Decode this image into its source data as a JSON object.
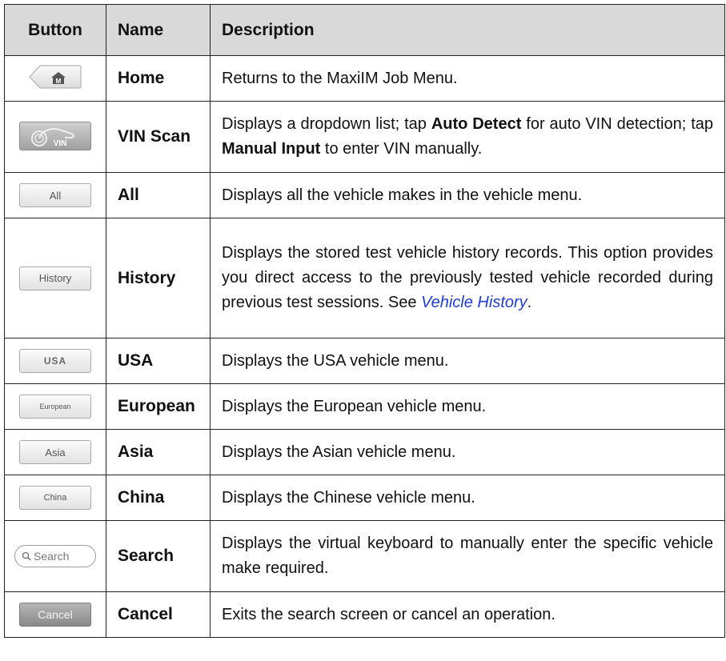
{
  "headers": {
    "button": "Button",
    "name": "Name",
    "description": "Description"
  },
  "rows": [
    {
      "icon_name": "home-icon",
      "icon_label": "",
      "name": "Home",
      "desc": [
        "Returns to the MaxiIM Job Menu."
      ]
    },
    {
      "icon_name": "vin-scan-icon",
      "icon_label": "VIN",
      "name": "VIN Scan",
      "desc": [
        "Displays a dropdown list; tap ",
        "Auto Detect",
        " for auto VIN detection; tap ",
        "Manual Input",
        " to enter VIN manually."
      ]
    },
    {
      "icon_name": "all-button-icon",
      "icon_label": "All",
      "name": "All",
      "desc": [
        "Displays all the vehicle makes in the vehicle menu."
      ]
    },
    {
      "icon_name": "history-button-icon",
      "icon_label": "History",
      "name": "History",
      "desc": [
        "Displays the stored test vehicle history records. This option provides you direct access to the previously tested vehicle recorded during previous test sessions. See ",
        "Vehicle History",
        "."
      ]
    },
    {
      "icon_name": "usa-button-icon",
      "icon_label": "USA",
      "name": "USA",
      "desc": [
        "Displays the USA vehicle menu."
      ]
    },
    {
      "icon_name": "european-button-icon",
      "icon_label": "European",
      "name": "European",
      "desc": [
        "Displays the European vehicle menu."
      ]
    },
    {
      "icon_name": "asia-button-icon",
      "icon_label": "Asia",
      "name": "Asia",
      "desc": [
        "Displays the Asian vehicle menu."
      ]
    },
    {
      "icon_name": "china-button-icon",
      "icon_label": "China",
      "name": "China",
      "desc": [
        "Displays the Chinese vehicle menu."
      ]
    },
    {
      "icon_name": "search-button-icon",
      "icon_label": "Search",
      "name": "Search",
      "desc": [
        "Displays the virtual keyboard to manually enter the specific vehicle make required."
      ]
    },
    {
      "icon_name": "cancel-button-icon",
      "icon_label": "Cancel",
      "name": "Cancel",
      "desc": [
        "Exits the search screen or cancel an operation."
      ]
    }
  ],
  "colors": {
    "header_bg": "#d9d9d9",
    "link": "#1f3cd6",
    "border": "#222222"
  }
}
